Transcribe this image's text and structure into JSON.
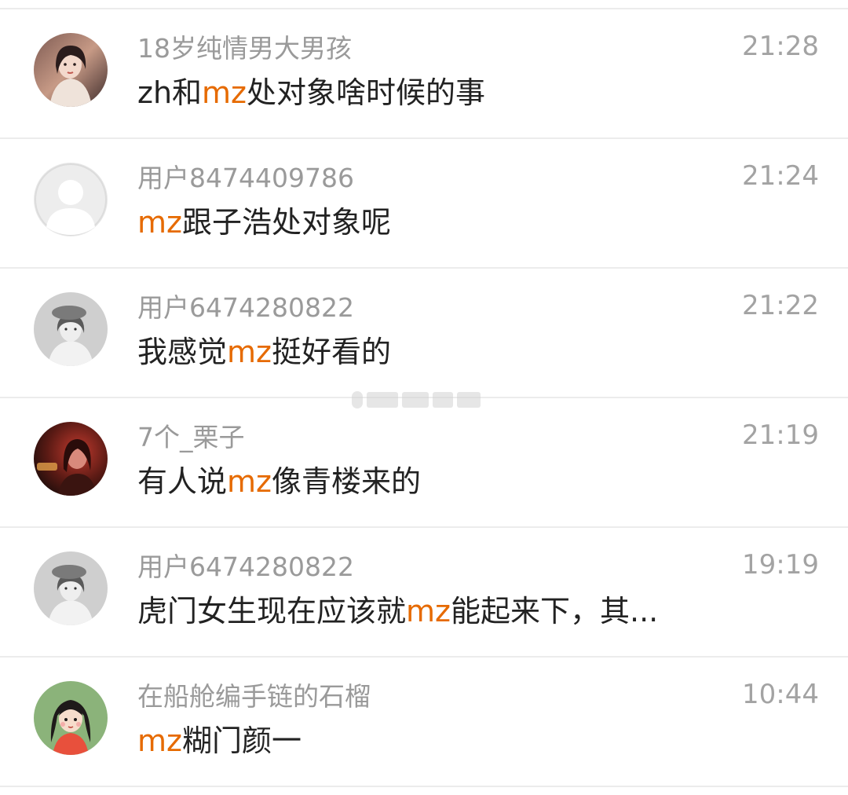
{
  "comments": [
    {
      "avatar_icon": "avatar-woman-photo-icon",
      "username": "18岁纯情男大男孩",
      "time": "21:28",
      "message": {
        "pre": "zh和",
        "hl": "mz",
        "post": "处对象啥时候的事"
      }
    },
    {
      "avatar_icon": "default-user-avatar-icon",
      "username": "用户8474409786",
      "time": "21:24",
      "message": {
        "pre": "",
        "hl": "mz",
        "post": "跟子浩处对象呢"
      }
    },
    {
      "avatar_icon": "avatar-girl-beret-photo-icon",
      "username": "用户6474280822",
      "time": "21:22",
      "message": {
        "pre": "我感觉",
        "hl": "mz",
        "post": "挺好看的"
      }
    },
    {
      "avatar_icon": "avatar-girl-red-light-photo-icon",
      "username": "7个_栗子",
      "time": "21:19",
      "message": {
        "pre": "有人说",
        "hl": "mz",
        "post": "像青楼来的"
      }
    },
    {
      "avatar_icon": "avatar-girl-beret-photo-icon",
      "username": "用户6474280822",
      "time": "19:19",
      "message": {
        "pre": "虎门女生现在应该就",
        "hl": "mz",
        "post": "能起来下，其..."
      }
    },
    {
      "avatar_icon": "avatar-cartoon-girl-icon",
      "username": "在船舱编手链的石榴",
      "time": "10:44",
      "message": {
        "pre": "",
        "hl": "mz",
        "post": "糊门颜一"
      }
    }
  ],
  "colors": {
    "highlight": "#e66a00",
    "username": "#9a9a9a",
    "message": "#222222",
    "time": "#a3a3a3",
    "divider": "#ececec"
  }
}
